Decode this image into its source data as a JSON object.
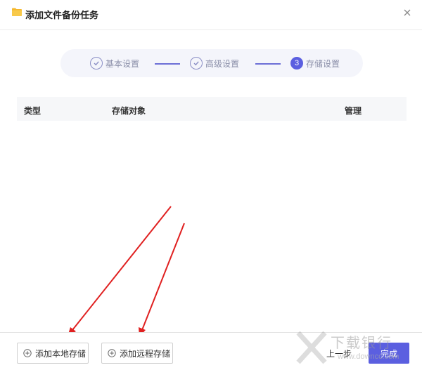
{
  "window": {
    "title": "添加文件备份任务"
  },
  "steps": [
    {
      "label": "基本设置",
      "state": "done"
    },
    {
      "label": "高级设置",
      "state": "done"
    },
    {
      "number": "3",
      "label": "存储设置",
      "state": "active"
    }
  ],
  "table": {
    "columns": [
      "类型",
      "存储对象",
      "管理"
    ],
    "rows": []
  },
  "footer": {
    "add_local": "添加本地存储",
    "add_remote": "添加远程存储",
    "prev": "上一步",
    "finish": "完成"
  },
  "watermark": {
    "text": "下载银行",
    "sub": "www.downcc.com"
  },
  "colors": {
    "accent": "#5b5fe0",
    "arrow": "#e02020",
    "folder": "#f5b82e"
  }
}
